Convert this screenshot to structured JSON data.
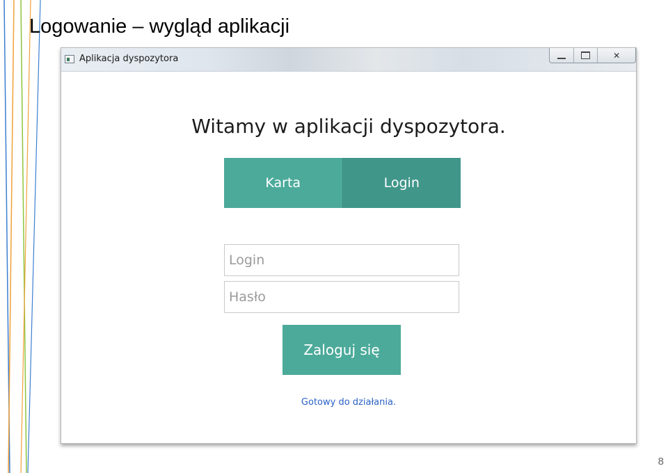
{
  "slide": {
    "title": "Logowanie – wygląd aplikacji",
    "page_number": "8"
  },
  "window": {
    "title": "Aplikacja dyspozytora",
    "icon": "app-window-icon",
    "controls": [
      "minimize-icon",
      "maximize-icon",
      "close-icon"
    ]
  },
  "main": {
    "welcome": "Witamy w aplikacji dyspozytora.",
    "tabs": [
      {
        "label": "Karta",
        "selected": false
      },
      {
        "label": "Login",
        "selected": true
      }
    ],
    "login_placeholder": "Login",
    "password_placeholder": "Hasło",
    "submit_label": "Zaloguj się",
    "status": "Gotowy do działania."
  },
  "colors": {
    "accent": "#4caa9a",
    "accent_selected": "#41968a",
    "status_text": "#2a62c4"
  }
}
